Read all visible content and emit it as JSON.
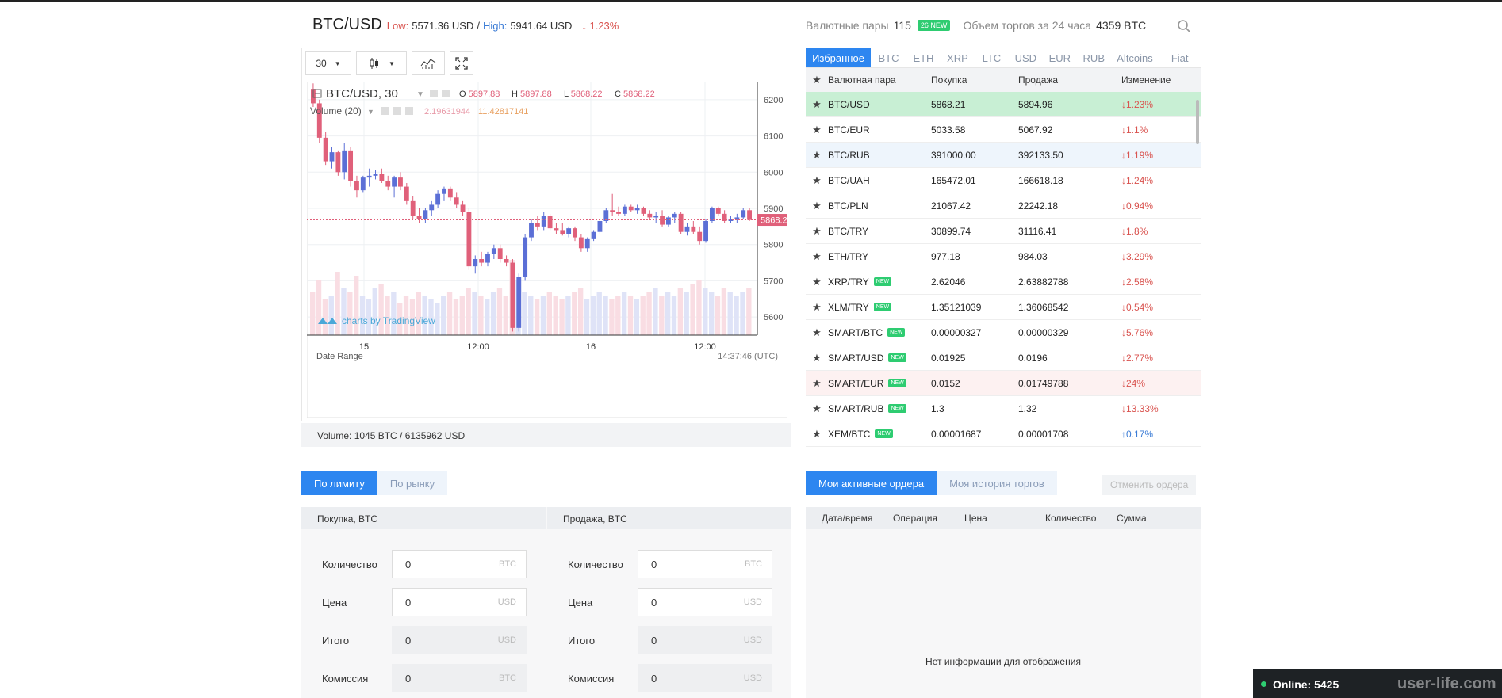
{
  "header": {
    "pair": "BTC/USD",
    "low_label": "Low:",
    "low_value": "5571.36 USD",
    "high_label": "High:",
    "high_value": "5941.64 USD",
    "change": "↓ 1.23%",
    "pairs_label": "Валютные пары",
    "pairs_count": "115",
    "new_badge": "26 NEW",
    "volume_label": "Объем торгов за 24 часа",
    "volume_value": "4359 BTC"
  },
  "chart_toolbar": {
    "interval": "30"
  },
  "chart_legend": {
    "symbol": "BTC/USD, 30",
    "o": "5897.88",
    "h": "5897.88",
    "l": "5868.22",
    "c": "5868.22",
    "volume_label": "Volume (20)",
    "vol1": "2.19631944",
    "vol2": "11.42817141",
    "watermark": "charts by TradingView",
    "date_range": "Date Range",
    "time": "14:37:46 (UTC)",
    "current_price": "5868.22"
  },
  "chart_data": {
    "type": "candlestick",
    "ylim": [
      5550,
      6250
    ],
    "yticks": [
      6200,
      6100,
      6000,
      5900,
      5800,
      5700,
      5600
    ],
    "xticks": [
      "15",
      "12:00",
      "16",
      "12:00"
    ],
    "candles": [
      [
        6230,
        6245,
        6180,
        6190
      ],
      [
        6190,
        6200,
        6080,
        6095
      ],
      [
        6095,
        6110,
        6020,
        6030
      ],
      [
        6030,
        6070,
        6010,
        6055
      ],
      [
        6055,
        6060,
        5990,
        6000
      ],
      [
        6000,
        6080,
        5980,
        6060
      ],
      [
        6060,
        6070,
        5960,
        5975
      ],
      [
        5975,
        5990,
        5930,
        5950
      ],
      [
        5950,
        5990,
        5945,
        5985
      ],
      [
        5985,
        6010,
        5960,
        5990
      ],
      [
        5990,
        6005,
        5980,
        5995
      ],
      [
        5995,
        6010,
        5970,
        5975
      ],
      [
        5975,
        5990,
        5950,
        5960
      ],
      [
        5960,
        5990,
        5930,
        5985
      ],
      [
        5985,
        6000,
        5950,
        5960
      ],
      [
        5960,
        5970,
        5910,
        5920
      ],
      [
        5920,
        5935,
        5870,
        5880
      ],
      [
        5880,
        5900,
        5860,
        5870
      ],
      [
        5870,
        5900,
        5860,
        5895
      ],
      [
        5895,
        5920,
        5880,
        5910
      ],
      [
        5910,
        5950,
        5900,
        5940
      ],
      [
        5940,
        5960,
        5920,
        5955
      ],
      [
        5955,
        5960,
        5920,
        5930
      ],
      [
        5930,
        5945,
        5900,
        5910
      ],
      [
        5910,
        5920,
        5880,
        5890
      ],
      [
        5890,
        5900,
        5730,
        5740
      ],
      [
        5740,
        5770,
        5720,
        5760
      ],
      [
        5760,
        5780,
        5740,
        5750
      ],
      [
        5750,
        5780,
        5740,
        5775
      ],
      [
        5775,
        5800,
        5760,
        5790
      ],
      [
        5790,
        5800,
        5750,
        5760
      ],
      [
        5760,
        5770,
        5740,
        5750
      ],
      [
        5750,
        5760,
        5560,
        5570
      ],
      [
        5570,
        5720,
        5560,
        5710
      ],
      [
        5710,
        5830,
        5700,
        5820
      ],
      [
        5820,
        5870,
        5810,
        5860
      ],
      [
        5860,
        5880,
        5840,
        5850
      ],
      [
        5850,
        5890,
        5840,
        5880
      ],
      [
        5880,
        5885,
        5840,
        5845
      ],
      [
        5845,
        5860,
        5830,
        5840
      ],
      [
        5840,
        5860,
        5825,
        5830
      ],
      [
        5830,
        5850,
        5820,
        5845
      ],
      [
        5845,
        5850,
        5810,
        5820
      ],
      [
        5820,
        5830,
        5780,
        5790
      ],
      [
        5790,
        5820,
        5780,
        5815
      ],
      [
        5815,
        5840,
        5810,
        5835
      ],
      [
        5835,
        5870,
        5830,
        5865
      ],
      [
        5865,
        5900,
        5860,
        5895
      ],
      [
        5895,
        5940,
        5880,
        5890
      ],
      [
        5890,
        5905,
        5880,
        5885
      ],
      [
        5885,
        5910,
        5880,
        5905
      ],
      [
        5905,
        5910,
        5890,
        5895
      ],
      [
        5895,
        5910,
        5885,
        5900
      ],
      [
        5900,
        5905,
        5880,
        5885
      ],
      [
        5885,
        5895,
        5870,
        5875
      ],
      [
        5875,
        5890,
        5860,
        5880
      ],
      [
        5880,
        5895,
        5850,
        5855
      ],
      [
        5855,
        5880,
        5850,
        5875
      ],
      [
        5875,
        5890,
        5860,
        5885
      ],
      [
        5885,
        5890,
        5830,
        5835
      ],
      [
        5835,
        5860,
        5825,
        5850
      ],
      [
        5850,
        5865,
        5830,
        5835
      ],
      [
        5835,
        5850,
        5800,
        5810
      ],
      [
        5810,
        5870,
        5805,
        5865
      ],
      [
        5865,
        5905,
        5860,
        5900
      ],
      [
        5900,
        5905,
        5880,
        5885
      ],
      [
        5885,
        5895,
        5860,
        5865
      ],
      [
        5865,
        5880,
        5860,
        5870
      ],
      [
        5870,
        5885,
        5860,
        5875
      ],
      [
        5875,
        5900,
        5870,
        5895
      ],
      [
        5895,
        5900,
        5865,
        5868
      ]
    ],
    "volumes": [
      0.55,
      0.7,
      0.45,
      0.5,
      0.8,
      0.6,
      0.55,
      0.75,
      0.5,
      0.45,
      0.6,
      0.65,
      0.5,
      0.55,
      0.4,
      0.5,
      0.45,
      0.55,
      0.5,
      0.45,
      0.4,
      0.5,
      0.55,
      0.45,
      0.5,
      0.6,
      0.55,
      0.5,
      0.45,
      0.55,
      0.6,
      0.5,
      0.95,
      0.7,
      0.55,
      0.5,
      0.45,
      0.5,
      0.55,
      0.5,
      0.45,
      0.5,
      0.55,
      0.6,
      0.45,
      0.5,
      0.55,
      0.5,
      0.45,
      0.5,
      0.55,
      0.5,
      0.45,
      0.5,
      0.55,
      0.6,
      0.5,
      0.55,
      0.5,
      0.6,
      0.55,
      0.65,
      0.7,
      0.6,
      0.55,
      0.5,
      0.6,
      0.55,
      0.5,
      0.55,
      0.6
    ]
  },
  "chart_footer": "Volume: 1045 BTC / 6135962 USD",
  "market": {
    "tabs": [
      "Избранное",
      "BTC",
      "ETH",
      "XRP",
      "LTC",
      "USD",
      "EUR",
      "RUB",
      "Altcoins",
      "Fiat"
    ],
    "columns": [
      "Валютная пара",
      "Покупка",
      "Продажа",
      "Изменение"
    ],
    "rows": [
      {
        "pair": "BTC/USD",
        "new": "",
        "buy": "5868.21",
        "sell": "5894.96",
        "change": "↓1.23%"
      },
      {
        "pair": "BTC/EUR",
        "new": "",
        "buy": "5033.58",
        "sell": "5067.92",
        "change": "↓1.1%"
      },
      {
        "pair": "BTC/RUB",
        "new": "",
        "buy": "391000.00",
        "sell": "392133.50",
        "change": "↓1.19%"
      },
      {
        "pair": "BTC/UAH",
        "new": "",
        "buy": "165472.01",
        "sell": "166618.18",
        "change": "↓1.24%"
      },
      {
        "pair": "BTC/PLN",
        "new": "",
        "buy": "21067.42",
        "sell": "22242.18",
        "change": "↓0.94%"
      },
      {
        "pair": "BTC/TRY",
        "new": "",
        "buy": "30899.74",
        "sell": "31116.41",
        "change": "↓1.8%"
      },
      {
        "pair": "ETH/TRY",
        "new": "",
        "buy": "977.18",
        "sell": "984.03",
        "change": "↓3.29%"
      },
      {
        "pair": "XRP/TRY",
        "new": "NEW",
        "buy": "2.62046",
        "sell": "2.63882788",
        "change": "↓2.58%"
      },
      {
        "pair": "XLM/TRY",
        "new": "NEW",
        "buy": "1.35121039",
        "sell": "1.36068542",
        "change": "↓0.54%"
      },
      {
        "pair": "SMART/BTC",
        "new": "NEW",
        "buy": "0.00000327",
        "sell": "0.00000329",
        "change": "↓5.76%"
      },
      {
        "pair": "SMART/USD",
        "new": "NEW",
        "buy": "0.01925",
        "sell": "0.0196",
        "change": "↓2.77%"
      },
      {
        "pair": "SMART/EUR",
        "new": "NEW",
        "buy": "0.0152",
        "sell": "0.01749788",
        "change": "↓24%"
      },
      {
        "pair": "SMART/RUB",
        "new": "NEW",
        "buy": "1.3",
        "sell": "1.32",
        "change": "↓13.33%"
      },
      {
        "pair": "XEM/BTC",
        "new": "NEW",
        "buy": "0.00001687",
        "sell": "0.00001708",
        "change": "↑0.17%"
      }
    ]
  },
  "order_tabs": [
    "По лимиту",
    "По рынку"
  ],
  "buy_form": {
    "title": "Покупка, BTC",
    "fields": [
      {
        "label": "Количество",
        "value": "0",
        "unit": "BTC"
      },
      {
        "label": "Цена",
        "value": "0",
        "unit": "USD"
      },
      {
        "label": "Итого",
        "value": "0",
        "unit": "USD"
      },
      {
        "label": "Комиссия",
        "value": "0",
        "unit": "BTC"
      }
    ]
  },
  "sell_form": {
    "title": "Продажа, BTC",
    "fields": [
      {
        "label": "Количество",
        "value": "0",
        "unit": "BTC"
      },
      {
        "label": "Цена",
        "value": "0",
        "unit": "USD"
      },
      {
        "label": "Итого",
        "value": "0",
        "unit": "USD"
      },
      {
        "label": "Комиссия",
        "value": "0",
        "unit": "USD"
      }
    ]
  },
  "orders": {
    "tabs": [
      "Мои активные ордера",
      "Моя история торгов"
    ],
    "cancel": "Отменить ордера",
    "columns": [
      "Дата/время",
      "Операция",
      "Цена",
      "Количество",
      "Сумма"
    ],
    "empty": "Нет информации для отображения"
  },
  "online": "Online: 5425",
  "watermark": "user-life.com",
  "colors": {
    "accent": "#2d86f0",
    "up": "#5b6fd6",
    "down": "#e0607a",
    "green": "#2ecc71"
  }
}
